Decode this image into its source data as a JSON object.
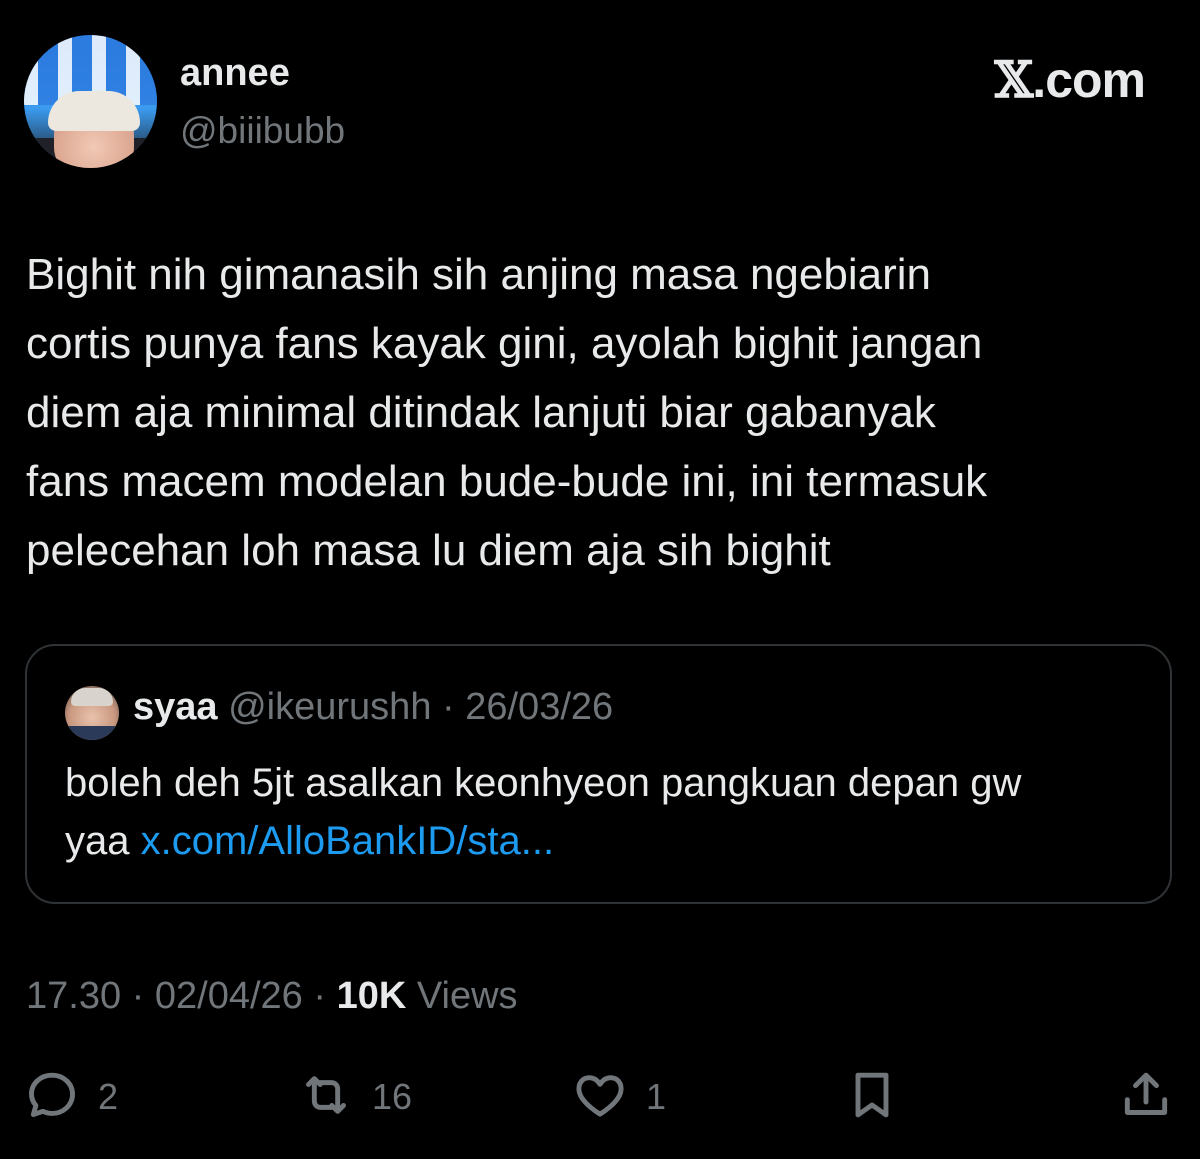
{
  "author": {
    "display_name": "annee",
    "handle": "@biiibubb"
  },
  "brand": {
    "x_glyph": "𝕏",
    "suffix": ".com"
  },
  "tweet": {
    "lines": [
      "Bighit nih gimanasih sih anjing masa ngebiarin",
      "cortis punya fans kayak gini, ayolah bighit jangan",
      "diem aja minimal ditindak lanjuti biar gabanyak",
      "fans macem modelan bude-bude ini, ini termasuk",
      "pelecehan loh masa lu diem aja sih bighit"
    ]
  },
  "quote": {
    "name": "syaa",
    "handle": "@ikeurushh",
    "separator": " · ",
    "date": "26/03/26",
    "text_line1": "boleh deh 5jt asalkan keonhyeon pangkuan depan gw",
    "text_line2_prefix": "yaa ",
    "link": "x.com/AlloBankID/sta..."
  },
  "meta": {
    "time": "17.30",
    "separator": " · ",
    "date": "02/04/26",
    "views_count": "10K",
    "views_label": " Views"
  },
  "actions": {
    "replies": "2",
    "reposts": "16",
    "likes": "1"
  },
  "colors": {
    "background": "#000000",
    "text": "#e7e9ea",
    "secondary": "#71767b",
    "link": "#1d9bf0",
    "border": "#2f3336"
  },
  "icons": [
    "reply-icon",
    "repost-icon",
    "like-icon",
    "bookmark-icon",
    "share-icon"
  ]
}
